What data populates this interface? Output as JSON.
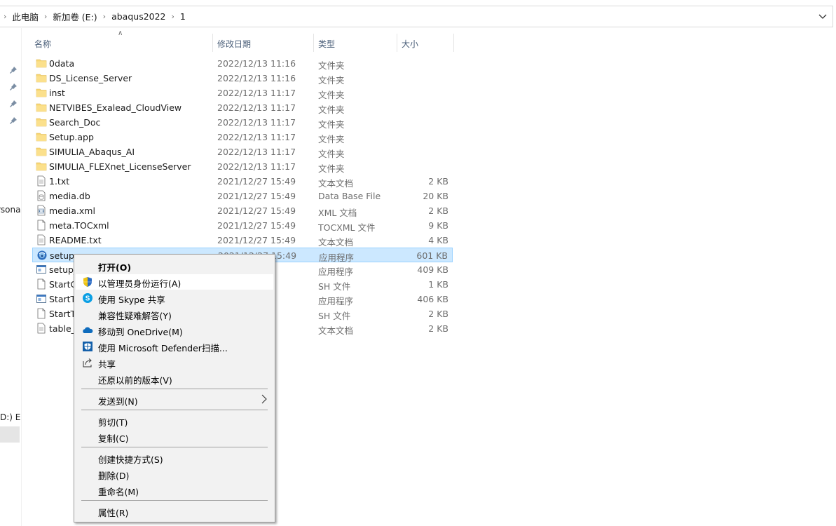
{
  "breadcrumb": {
    "items": [
      "此电脑",
      "新加卷 (E:)",
      "abaqus2022",
      "1"
    ]
  },
  "nav": {
    "partial_texts": [
      "rsona",
      "D:) E"
    ]
  },
  "columns": {
    "name": "名称",
    "date": "修改日期",
    "type": "类型",
    "size": "大小"
  },
  "files": [
    {
      "name": "0data",
      "date": "2022/12/13 11:16",
      "type": "文件夹",
      "size": "",
      "icon": "folder-icon"
    },
    {
      "name": "DS_License_Server",
      "date": "2022/12/13 11:16",
      "type": "文件夹",
      "size": "",
      "icon": "folder-icon"
    },
    {
      "name": "inst",
      "date": "2022/12/13 11:17",
      "type": "文件夹",
      "size": "",
      "icon": "folder-icon"
    },
    {
      "name": "NETVIBES_Exalead_CloudView",
      "date": "2022/12/13 11:17",
      "type": "文件夹",
      "size": "",
      "icon": "folder-icon"
    },
    {
      "name": "Search_Doc",
      "date": "2022/12/13 11:17",
      "type": "文件夹",
      "size": "",
      "icon": "folder-icon"
    },
    {
      "name": "Setup.app",
      "date": "2022/12/13 11:17",
      "type": "文件夹",
      "size": "",
      "icon": "folder-icon"
    },
    {
      "name": "SIMULIA_Abaqus_AI",
      "date": "2022/12/13 11:17",
      "type": "文件夹",
      "size": "",
      "icon": "folder-icon"
    },
    {
      "name": "SIMULIA_FLEXnet_LicenseServer",
      "date": "2022/12/13 11:17",
      "type": "文件夹",
      "size": "",
      "icon": "folder-icon"
    },
    {
      "name": "1.txt",
      "date": "2021/12/27 15:49",
      "type": "文本文档",
      "size": "2 KB",
      "icon": "text-file-icon"
    },
    {
      "name": "media.db",
      "date": "2021/12/27 15:49",
      "type": "Data Base File",
      "size": "20 KB",
      "icon": "db-file-icon"
    },
    {
      "name": "media.xml",
      "date": "2021/12/27 15:49",
      "type": "XML 文档",
      "size": "2 KB",
      "icon": "xml-file-icon"
    },
    {
      "name": "meta.TOCxml",
      "date": "2021/12/27 15:49",
      "type": "TOCXML 文件",
      "size": "9 KB",
      "icon": "file-icon"
    },
    {
      "name": "README.txt",
      "date": "2021/12/27 15:49",
      "type": "文本文档",
      "size": "4 KB",
      "icon": "text-file-icon"
    },
    {
      "name": "setup.",
      "date": "2021/12/27 15:49",
      "type": "应用程序",
      "size": "601 KB",
      "icon": "setup-exe-icon",
      "selected": true
    },
    {
      "name": "setup_",
      "date": "49",
      "type": "应用程序",
      "size": "409 KB",
      "icon": "app-icon"
    },
    {
      "name": "StartG",
      "date": "50",
      "type": "SH 文件",
      "size": "1 KB",
      "icon": "file-icon"
    },
    {
      "name": "StartT",
      "date": "49",
      "type": "应用程序",
      "size": "406 KB",
      "icon": "app-icon"
    },
    {
      "name": "StartT",
      "date": "49",
      "type": "SH 文件",
      "size": "2 KB",
      "icon": "file-icon"
    },
    {
      "name": "table_",
      "date": "49",
      "type": "文本文档",
      "size": "2 KB",
      "icon": "text-file-icon"
    }
  ],
  "context_menu": {
    "items": [
      {
        "label": "打开(O)",
        "bold": true,
        "icon": ""
      },
      {
        "label": "以管理员身份运行(A)",
        "highlighted": true,
        "icon": "uac-shield-icon"
      },
      {
        "label": "使用 Skype 共享",
        "icon": "skype-icon"
      },
      {
        "label": "兼容性疑难解答(Y)",
        "icon": ""
      },
      {
        "label": "移动到 OneDrive(M)",
        "icon": "onedrive-icon"
      },
      {
        "label": "使用 Microsoft Defender扫描...",
        "icon": "defender-icon"
      },
      {
        "label": "共享",
        "icon": "share-icon"
      },
      {
        "label": "还原以前的版本(V)",
        "icon": ""
      },
      {
        "label": "发送到(N)",
        "icon": "",
        "submenu": true
      },
      {
        "label": "剪切(T)",
        "icon": ""
      },
      {
        "label": "复制(C)",
        "icon": ""
      },
      {
        "label": "创建快捷方式(S)",
        "icon": ""
      },
      {
        "label": "删除(D)",
        "icon": ""
      },
      {
        "label": "重命名(M)",
        "icon": ""
      },
      {
        "label": "属性(R)",
        "icon": ""
      }
    ]
  },
  "colors": {
    "selection_bg": "#cce8ff",
    "selection_border": "#99d1ff",
    "folder": "#f8d775",
    "menu_bg": "#f2f2f2"
  }
}
